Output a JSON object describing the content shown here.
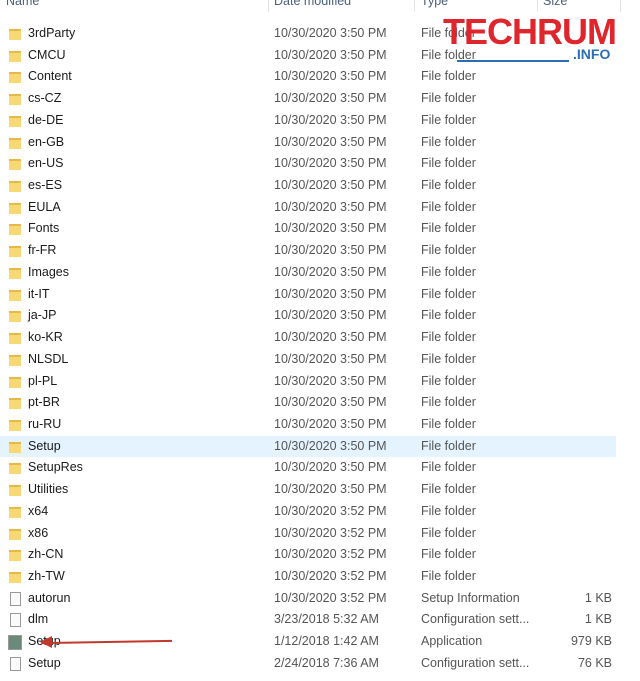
{
  "columns": {
    "name": "Name",
    "date": "Date modified",
    "type": "Type",
    "size": "Size"
  },
  "watermark": {
    "main": "TECHRUM",
    "sub": ".INFO"
  },
  "selected_index": 19,
  "files": [
    {
      "name": "3rdParty",
      "date": "10/30/2020 3:50 PM",
      "type": "File folder",
      "size": "",
      "icon": "folder"
    },
    {
      "name": "CMCU",
      "date": "10/30/2020 3:50 PM",
      "type": "File folder",
      "size": "",
      "icon": "folder"
    },
    {
      "name": "Content",
      "date": "10/30/2020 3:50 PM",
      "type": "File folder",
      "size": "",
      "icon": "folder"
    },
    {
      "name": "cs-CZ",
      "date": "10/30/2020 3:50 PM",
      "type": "File folder",
      "size": "",
      "icon": "folder"
    },
    {
      "name": "de-DE",
      "date": "10/30/2020 3:50 PM",
      "type": "File folder",
      "size": "",
      "icon": "folder"
    },
    {
      "name": "en-GB",
      "date": "10/30/2020 3:50 PM",
      "type": "File folder",
      "size": "",
      "icon": "folder"
    },
    {
      "name": "en-US",
      "date": "10/30/2020 3:50 PM",
      "type": "File folder",
      "size": "",
      "icon": "folder"
    },
    {
      "name": "es-ES",
      "date": "10/30/2020 3:50 PM",
      "type": "File folder",
      "size": "",
      "icon": "folder"
    },
    {
      "name": "EULA",
      "date": "10/30/2020 3:50 PM",
      "type": "File folder",
      "size": "",
      "icon": "folder"
    },
    {
      "name": "Fonts",
      "date": "10/30/2020 3:50 PM",
      "type": "File folder",
      "size": "",
      "icon": "folder"
    },
    {
      "name": "fr-FR",
      "date": "10/30/2020 3:50 PM",
      "type": "File folder",
      "size": "",
      "icon": "folder"
    },
    {
      "name": "Images",
      "date": "10/30/2020 3:50 PM",
      "type": "File folder",
      "size": "",
      "icon": "folder"
    },
    {
      "name": "it-IT",
      "date": "10/30/2020 3:50 PM",
      "type": "File folder",
      "size": "",
      "icon": "folder"
    },
    {
      "name": "ja-JP",
      "date": "10/30/2020 3:50 PM",
      "type": "File folder",
      "size": "",
      "icon": "folder"
    },
    {
      "name": "ko-KR",
      "date": "10/30/2020 3:50 PM",
      "type": "File folder",
      "size": "",
      "icon": "folder"
    },
    {
      "name": "NLSDL",
      "date": "10/30/2020 3:50 PM",
      "type": "File folder",
      "size": "",
      "icon": "folder"
    },
    {
      "name": "pl-PL",
      "date": "10/30/2020 3:50 PM",
      "type": "File folder",
      "size": "",
      "icon": "folder"
    },
    {
      "name": "pt-BR",
      "date": "10/30/2020 3:50 PM",
      "type": "File folder",
      "size": "",
      "icon": "folder"
    },
    {
      "name": "ru-RU",
      "date": "10/30/2020 3:50 PM",
      "type": "File folder",
      "size": "",
      "icon": "folder"
    },
    {
      "name": "Setup",
      "date": "10/30/2020 3:50 PM",
      "type": "File folder",
      "size": "",
      "icon": "folder"
    },
    {
      "name": "SetupRes",
      "date": "10/30/2020 3:50 PM",
      "type": "File folder",
      "size": "",
      "icon": "folder"
    },
    {
      "name": "Utilities",
      "date": "10/30/2020 3:50 PM",
      "type": "File folder",
      "size": "",
      "icon": "folder"
    },
    {
      "name": "x64",
      "date": "10/30/2020 3:52 PM",
      "type": "File folder",
      "size": "",
      "icon": "folder"
    },
    {
      "name": "x86",
      "date": "10/30/2020 3:52 PM",
      "type": "File folder",
      "size": "",
      "icon": "folder"
    },
    {
      "name": "zh-CN",
      "date": "10/30/2020 3:52 PM",
      "type": "File folder",
      "size": "",
      "icon": "folder"
    },
    {
      "name": "zh-TW",
      "date": "10/30/2020 3:52 PM",
      "type": "File folder",
      "size": "",
      "icon": "folder"
    },
    {
      "name": "autorun",
      "date": "10/30/2020 3:52 PM",
      "type": "Setup Information",
      "size": "1 KB",
      "icon": "file"
    },
    {
      "name": "dlm",
      "date": "3/23/2018 5:32 AM",
      "type": "Configuration sett...",
      "size": "1 KB",
      "icon": "file"
    },
    {
      "name": "Setup",
      "date": "1/12/2018 1:42 AM",
      "type": "Application",
      "size": "979 KB",
      "icon": "app"
    },
    {
      "name": "Setup",
      "date": "2/24/2018 7:36 AM",
      "type": "Configuration sett...",
      "size": "76 KB",
      "icon": "file"
    }
  ]
}
